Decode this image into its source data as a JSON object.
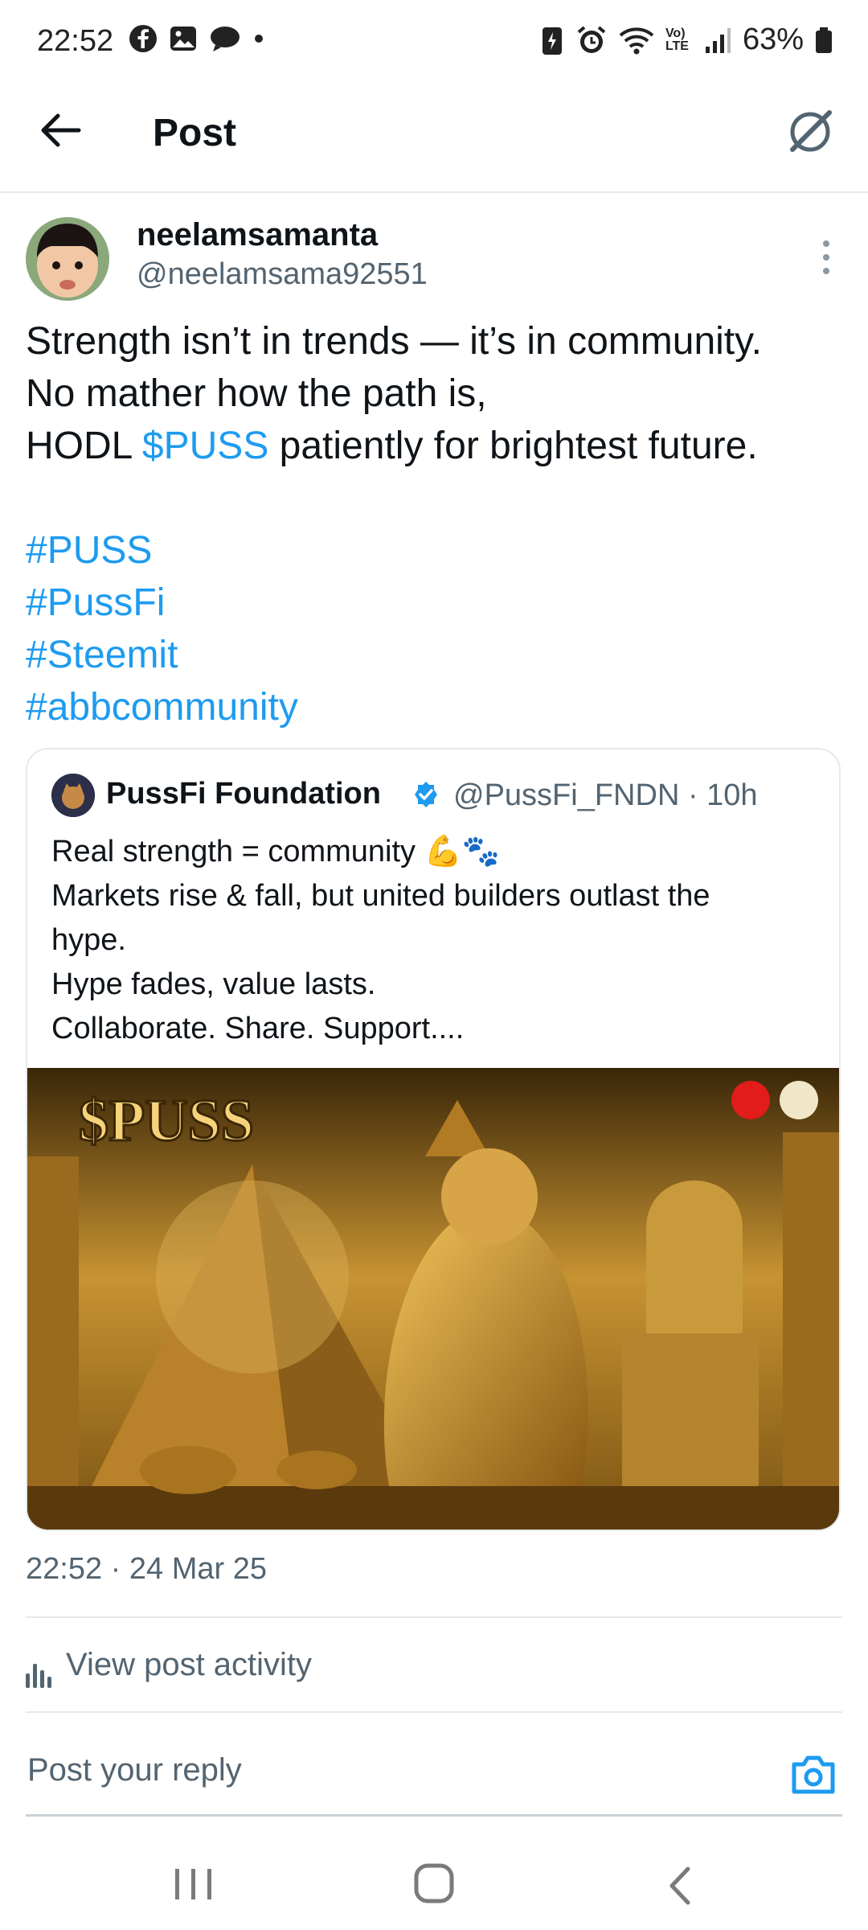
{
  "status": {
    "time": "22:52",
    "battery": "63%",
    "network": "Vo) LTE"
  },
  "appbar": {
    "title": "Post"
  },
  "post": {
    "display_name": "neelamsamanta",
    "handle": "@neelamsama92551",
    "lines": [
      [
        "Strength isn’t in trends — it’s in community.",
        ""
      ],
      [
        "No mather how the path is,",
        ""
      ]
    ],
    "line1": "Strength isn’t in trends — it’s in community.",
    "line2": "No mather how the path is,",
    "line3_pre": "HODL ",
    "line3_link": "$PUSS",
    "line3_post": " patiently for brightest future.",
    "hashtags": [
      "#PUSS",
      "#PussFi",
      "#Steemit",
      "#abbcommunity"
    ],
    "timestamp": "22:52 · 24 Mar 25"
  },
  "quote": {
    "name": "PussFi Foundation",
    "handle_time": "@PussFi_FNDN · 10h",
    "lines": [
      "Real strength = community 💪🐾",
      "Markets rise & fall, but united builders outlast the",
      "hype.",
      "Hype fades, value lasts.",
      "Collaborate. Share. Support...."
    ],
    "image_caption": "$PUSS"
  },
  "activity": {
    "label": "View post activity"
  },
  "reply": {
    "placeholder": "Post your reply"
  },
  "colors": {
    "link": "#1d9bf0",
    "secondary": "#536471",
    "verified": "#1d9bf0"
  }
}
